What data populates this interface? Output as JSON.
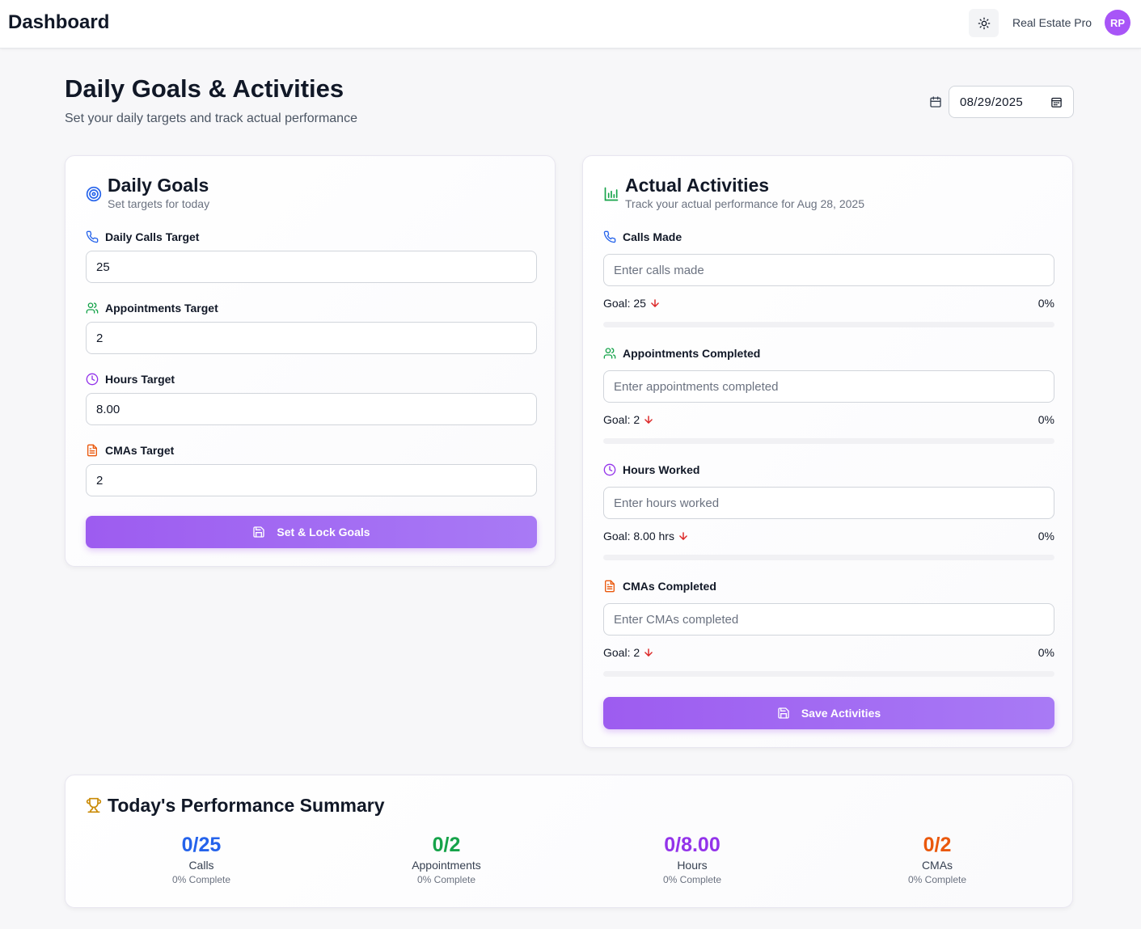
{
  "header": {
    "title": "Dashboard",
    "user_name": "Real Estate Pro",
    "avatar_initials": "RP"
  },
  "page": {
    "title": "Daily Goals & Activities",
    "subtitle": "Set your daily targets and track actual performance",
    "date": "08/29/2025"
  },
  "goals": {
    "title": "Daily Goals",
    "subtitle": "Set targets for today",
    "calls_label": "Daily Calls Target",
    "calls_value": "25",
    "appointments_label": "Appointments Target",
    "appointments_value": "2",
    "hours_label": "Hours Target",
    "hours_value": "8.00",
    "cmas_label": "CMAs Target",
    "cmas_value": "2",
    "button": "Set & Lock Goals"
  },
  "activities": {
    "title": "Actual Activities",
    "subtitle": "Track your actual performance for Aug 28, 2025",
    "calls": {
      "label": "Calls Made",
      "placeholder": "Enter calls made",
      "goal": "Goal: 25",
      "percent": "0%",
      "progress": 0
    },
    "appointments": {
      "label": "Appointments Completed",
      "placeholder": "Enter appointments completed",
      "goal": "Goal: 2",
      "percent": "0%",
      "progress": 0
    },
    "hours": {
      "label": "Hours Worked",
      "placeholder": "Enter hours worked",
      "goal": "Goal: 8.00 hrs",
      "percent": "0%",
      "progress": 0
    },
    "cmas": {
      "label": "CMAs Completed",
      "placeholder": "Enter CMAs completed",
      "goal": "Goal: 2",
      "percent": "0%",
      "progress": 0
    },
    "button": "Save Activities"
  },
  "summary": {
    "title": "Today's Performance Summary",
    "calls": {
      "value": "0/25",
      "name": "Calls",
      "pct": "0% Complete",
      "color": "#2563eb"
    },
    "appointments": {
      "value": "0/2",
      "name": "Appointments",
      "pct": "0% Complete",
      "color": "#16a34a"
    },
    "hours": {
      "value": "0/8.00",
      "name": "Hours",
      "pct": "0% Complete",
      "color": "#9333ea"
    },
    "cmas": {
      "value": "0/2",
      "name": "CMAs",
      "pct": "0% Complete",
      "color": "#ea580c"
    }
  },
  "icons": {
    "theme": "sun-icon",
    "date": "calendar-icon",
    "goals": "target-icon",
    "activities": "bar-chart-icon",
    "calls": "phone-icon",
    "appointments": "users-icon",
    "hours": "clock-icon",
    "cmas": "file-text-icon",
    "save": "save-icon",
    "trend": "arrow-down-icon",
    "summary": "trophy-icon"
  }
}
